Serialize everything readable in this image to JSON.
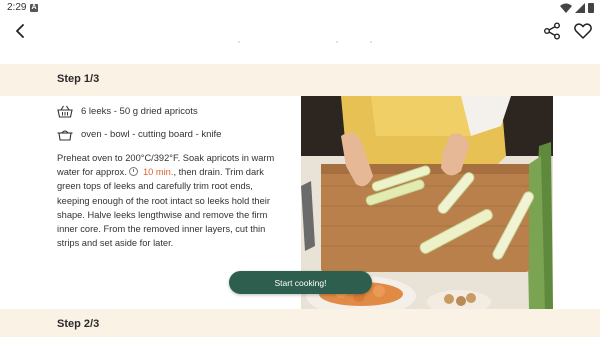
{
  "status_bar": {
    "time": "2:29",
    "notification_letter": "A"
  },
  "app_bar": {
    "back_icon": "arrow-back-icon",
    "share_icon": "share-icon",
    "favorite_icon": "heart-outline-icon"
  },
  "steps": [
    {
      "title": "Step 1/3",
      "ingredients": "6  leeks - 50 g dried apricots",
      "utensils": "oven - bowl - cutting board - knife",
      "instructions_before_timer": "Preheat oven to 200°C/392°F. Soak apricots in warm water for approx. ",
      "timer": "10 min.",
      "instructions_after_timer": ", then drain. Trim dark green tops of leeks and carefully trim root ends, keeping enough of the root intact so leeks hold their shape. Halve leeks lengthwise and remove the firm inner core. From the removed inner layers, cut thin strips and set aside for later."
    },
    {
      "title": "Step 2/3"
    }
  ],
  "start_button": {
    "label": "Start cooking!"
  },
  "colors": {
    "accent_green": "#2e5e4e",
    "timer_orange": "#e0632b",
    "step_header_bg": "#fbf2e6"
  }
}
